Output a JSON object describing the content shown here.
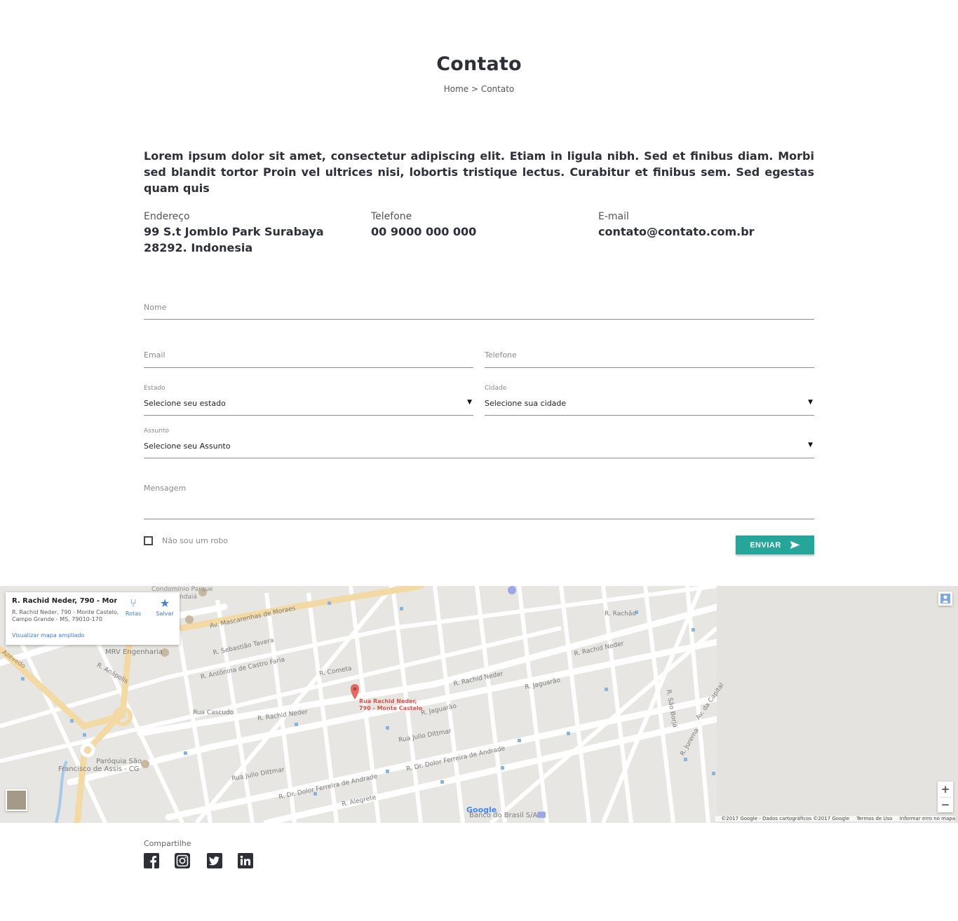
{
  "header": {
    "title": "Contato",
    "breadcrumb": "Home > Contato"
  },
  "intro": "Lorem ipsum dolor sit amet, consectetur adipiscing elit. Etiam in ligula nibh. Sed et finibus diam. Morbi sed blandit tortor Proin vel ultrices nisi, lobortis tristique lectus. Curabitur et finibus sem. Sed egestas quam quis",
  "info": {
    "address_label": "Endereço",
    "address_value": "99 S.t Jomblo Park Surabaya 28292. Indonesia",
    "phone_label": "Telefone",
    "phone_value": "00 9000 000 000",
    "email_label": "E-mail",
    "email_value": "contato@contato.com.br"
  },
  "form": {
    "nome": "Nome",
    "email": "Email",
    "telefone": "Telefone",
    "estado_label": "Estado",
    "estado_value": "Selecione seu estado",
    "cidade_label": "Cidade",
    "cidade_value": "Selecione sua cidade",
    "assunto_label": "Assunto",
    "assunto_value": "Selecione seu Assunto",
    "mensagem": "Mensagem",
    "robot_label": "Não sou um robo",
    "submit": "ENVIAR",
    "caret": "▼"
  },
  "map": {
    "card_title": "R. Rachid Neder, 790 - Monte ...",
    "card_address": "R. Rachid Neder, 790 - Monte Castelo, Campo Grande - MS, 79010-170",
    "card_link": "Visualizar mapa ampliado",
    "rotas": "Rotas",
    "salvar": "Salvar",
    "pin_label_1": "Rua Rachid Neder,",
    "pin_label_2": "790 - Monte Castelo",
    "google": "Google",
    "attribution": "©2017 Google - Dados cartográficos ©2017 Google",
    "terms": "Termos de Uso",
    "report": "Informar erro no mapa",
    "zoom_in": "+",
    "zoom_out": "−",
    "labels": {
      "condominio": "Condomínio Parque",
      "condominio2": "ndaiá",
      "mascarenhas": "Av. Mascarenhas de Moraes",
      "mrv": "MRV Engenharia",
      "sebastiao": "R. Sebastião Tavera",
      "antonina": "R. Antônina de Castro Faria",
      "cascudo": "Rua Cascudo",
      "rachid1": "R. Rachid Neder",
      "rachid2": "R. Rachid Neder",
      "rachid3": "R. Rachid Neder",
      "cometa": "R. Cometa",
      "jaguarao1": "R. Jaguarão",
      "jaguarao2": "R. Jaguarão",
      "juliodittmar1": "Rua Julio Dittmar",
      "juliodittmar2": "Rua Julio Dittmar",
      "dolor1": "R. Dr. Dolor Ferreira de Andrade",
      "dolor2": "R. Dr. Dolor Ferreira de Andrade",
      "alegrete": "R. Alegrete",
      "paroquia1": "Paróquia São",
      "paroquia2": "Francisco de Assis - CG",
      "banco": "Banco do Brasil S/A",
      "anapolis": "R. Anápolis",
      "azevedo": "Azevedo",
      "rachao": "R. Rachão",
      "saoborja": "R. São Borja",
      "capital": "Av. da Capital",
      "jurema": "R. Jurema"
    }
  },
  "share": {
    "label": "Compartilhe",
    "icons": [
      "facebook-icon",
      "instagram-icon",
      "twitter-icon",
      "linkedin-icon"
    ]
  },
  "colors": {
    "accent": "#26a69a",
    "text": "#2d3038",
    "link": "#3b78d8"
  }
}
